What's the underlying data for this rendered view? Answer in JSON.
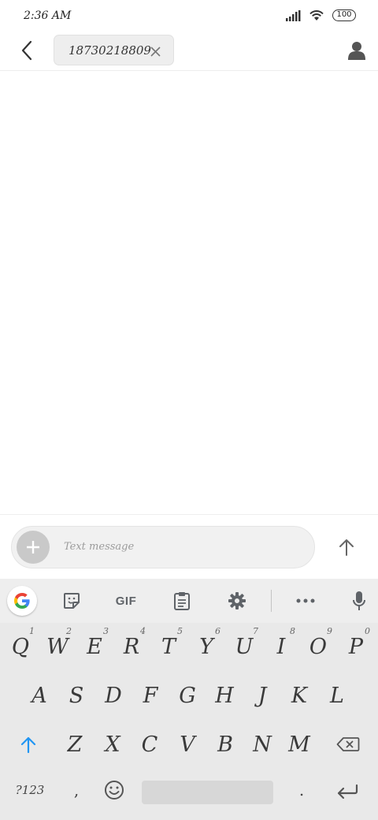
{
  "status_bar": {
    "time": "2:36 AM",
    "battery": "100",
    "icons": [
      "signal-icon",
      "wifi-icon",
      "battery-icon"
    ]
  },
  "header": {
    "back_icon": "chevron-left-icon",
    "recipient": "18730218809",
    "remove_icon": "close-icon",
    "contact_icon": "person-icon"
  },
  "compose": {
    "placeholder": "Text message",
    "add_icon": "plus-icon",
    "send_icon": "arrow-up-icon"
  },
  "keyboard": {
    "toolbar": {
      "google_label": "G",
      "sticker_icon": "sticker-icon",
      "gif_label": "GIF",
      "clipboard_icon": "clipboard-icon",
      "settings_icon": "gear-icon",
      "more_icon": "more-dots-icon",
      "mic_icon": "microphone-icon"
    },
    "row1": [
      {
        "key": "Q",
        "hint": "1"
      },
      {
        "key": "W",
        "hint": "2"
      },
      {
        "key": "E",
        "hint": "3"
      },
      {
        "key": "R",
        "hint": "4"
      },
      {
        "key": "T",
        "hint": "5"
      },
      {
        "key": "Y",
        "hint": "6"
      },
      {
        "key": "U",
        "hint": "7"
      },
      {
        "key": "I",
        "hint": "8"
      },
      {
        "key": "O",
        "hint": "9"
      },
      {
        "key": "P",
        "hint": "0"
      }
    ],
    "row2": [
      "A",
      "S",
      "D",
      "F",
      "G",
      "H",
      "J",
      "K",
      "L"
    ],
    "row3": [
      "Z",
      "X",
      "C",
      "V",
      "B",
      "N",
      "M"
    ],
    "shift_icon": "shift-arrow-icon",
    "backspace_icon": "backspace-icon",
    "symbols_label": "?123",
    "comma_label": ",",
    "emoji_icon": "emoji-icon",
    "period_label": ".",
    "enter_icon": "enter-icon"
  },
  "colors": {
    "accent_blue": "#2196F3",
    "google_blue": "#4285F4",
    "google_red": "#EA4335",
    "google_yellow": "#FBBC05",
    "google_green": "#34A853"
  }
}
